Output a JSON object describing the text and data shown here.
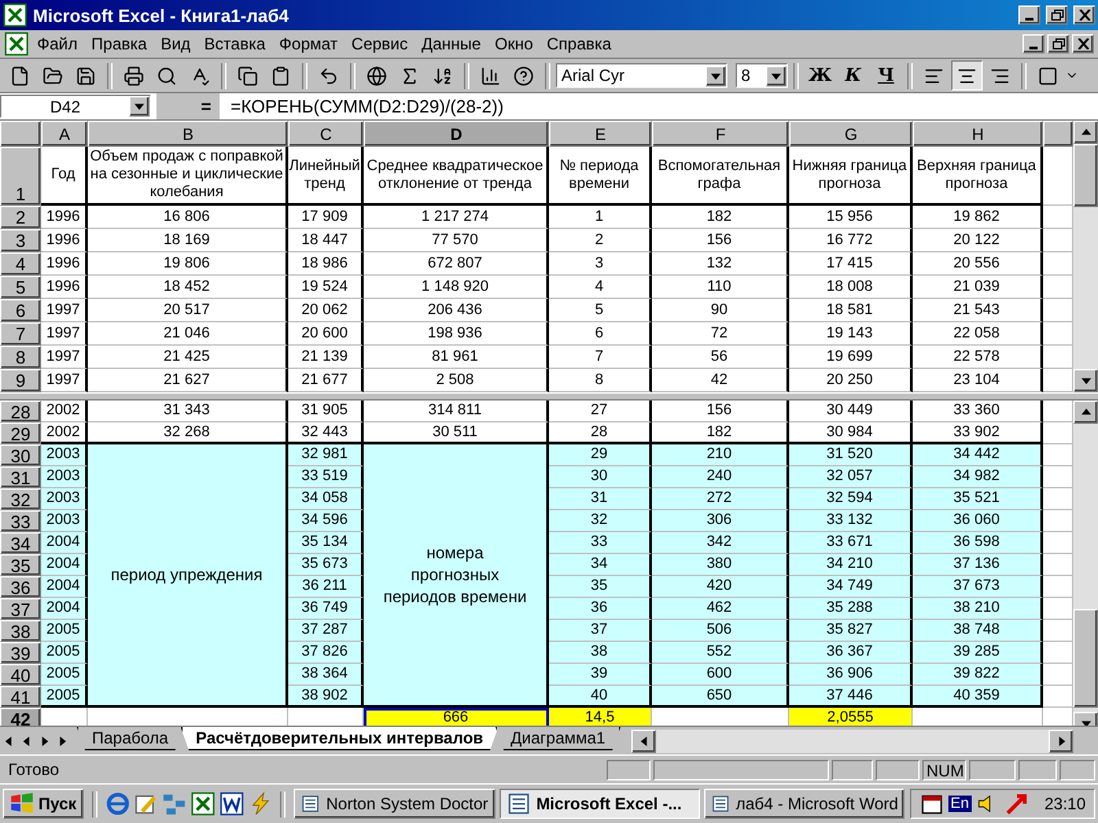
{
  "window": {
    "title": "Microsoft Excel - Книга1-лаб4"
  },
  "menu": [
    "Файл",
    "Правка",
    "Вид",
    "Вставка",
    "Формат",
    "Сервис",
    "Данные",
    "Окно",
    "Справка"
  ],
  "toolbar": {
    "font": "Arial Cyr",
    "size": "8",
    "format_buttons": [
      {
        "kind": "bold",
        "label": "Ж"
      },
      {
        "kind": "italic",
        "label": "К"
      },
      {
        "kind": "underline",
        "label": "Ч"
      }
    ],
    "align_buttons": [
      {
        "kind": "left",
        "selected": false
      },
      {
        "kind": "center",
        "selected": true
      },
      {
        "kind": "right",
        "selected": false
      }
    ]
  },
  "formula_bar": {
    "cell": "D42",
    "equals": "=",
    "formula": "=КОРЕНЬ(СУММ(D2:D29)/(28-2))"
  },
  "columns": [
    {
      "label": "A",
      "selected": false
    },
    {
      "label": "B",
      "selected": false
    },
    {
      "label": "C",
      "selected": false
    },
    {
      "label": "D",
      "selected": true
    },
    {
      "label": "E",
      "selected": false
    },
    {
      "label": "F",
      "selected": false
    },
    {
      "label": "G",
      "selected": false
    },
    {
      "label": "H",
      "selected": false
    }
  ],
  "header_row": {
    "row": "1",
    "cells": [
      "Год",
      "Объем продаж с поправкой на сезонные и циклические колебания",
      "Линейный тренд",
      "Среднее квадратическое отклонение от тренда",
      "№ периода времени",
      "Вспомогательная графа",
      "Нижняя граница прогноза",
      "Верхняя граница прогноза"
    ]
  },
  "top_rows": [
    {
      "row": "2",
      "cells": [
        "1996",
        "16 806",
        "17 909",
        "1 217 274",
        "1",
        "182",
        "15 956",
        "19 862"
      ]
    },
    {
      "row": "3",
      "cells": [
        "1996",
        "18 169",
        "18 447",
        "77 570",
        "2",
        "156",
        "16 772",
        "20 122"
      ]
    },
    {
      "row": "4",
      "cells": [
        "1996",
        "19 806",
        "18 986",
        "672 807",
        "3",
        "132",
        "17 415",
        "20 556"
      ]
    },
    {
      "row": "5",
      "cells": [
        "1996",
        "18 452",
        "19 524",
        "1 148 920",
        "4",
        "110",
        "18 008",
        "21 039"
      ]
    },
    {
      "row": "6",
      "cells": [
        "1997",
        "20 517",
        "20 062",
        "206 436",
        "5",
        "90",
        "18 581",
        "21 543"
      ]
    },
    {
      "row": "7",
      "cells": [
        "1997",
        "21 046",
        "20 600",
        "198 936",
        "6",
        "72",
        "19 143",
        "22 058"
      ]
    },
    {
      "row": "8",
      "cells": [
        "1997",
        "21 425",
        "21 139",
        "81 961",
        "7",
        "56",
        "19 699",
        "22 578"
      ]
    },
    {
      "row": "9",
      "cells": [
        "1997",
        "21 627",
        "21 677",
        "2 508",
        "8",
        "42",
        "20 250",
        "23 104"
      ]
    }
  ],
  "bottom_rows": [
    {
      "row": "28",
      "cells": [
        "2002",
        "31 343",
        "31 905",
        "314 811",
        "27",
        "156",
        "30 449",
        "33 360"
      ]
    },
    {
      "row": "29",
      "cells": [
        "2002",
        "32 268",
        "32 443",
        "30 511",
        "28",
        "182",
        "30 984",
        "33 902"
      ]
    }
  ],
  "forecast": {
    "label_b": "период упреждения",
    "label_d": "номера прогнозных периодов  времени",
    "rows": [
      {
        "row": "30",
        "cells": [
          "2003",
          "32 981",
          "29",
          "210",
          "31 520",
          "34 442"
        ]
      },
      {
        "row": "31",
        "cells": [
          "2003",
          "33 519",
          "30",
          "240",
          "32 057",
          "34 982"
        ]
      },
      {
        "row": "32",
        "cells": [
          "2003",
          "34 058",
          "31",
          "272",
          "32 594",
          "35 521"
        ]
      },
      {
        "row": "33",
        "cells": [
          "2003",
          "34 596",
          "32",
          "306",
          "33 132",
          "36 060"
        ]
      },
      {
        "row": "34",
        "cells": [
          "2004",
          "35 134",
          "33",
          "342",
          "33 671",
          "36 598"
        ]
      },
      {
        "row": "35",
        "cells": [
          "2004",
          "35 673",
          "34",
          "380",
          "34 210",
          "37 136"
        ]
      },
      {
        "row": "36",
        "cells": [
          "2004",
          "36 211",
          "35",
          "420",
          "34 749",
          "37 673"
        ]
      },
      {
        "row": "37",
        "cells": [
          "2004",
          "36 749",
          "36",
          "462",
          "35 288",
          "38 210"
        ]
      },
      {
        "row": "38",
        "cells": [
          "2005",
          "37 287",
          "37",
          "506",
          "35 827",
          "38 748"
        ]
      },
      {
        "row": "39",
        "cells": [
          "2005",
          "37 826",
          "38",
          "552",
          "36 367",
          "39 285"
        ]
      },
      {
        "row": "40",
        "cells": [
          "2005",
          "38 364",
          "39",
          "600",
          "36 906",
          "39 822"
        ]
      },
      {
        "row": "41",
        "cells": [
          "2005",
          "38 902",
          "40",
          "650",
          "37 446",
          "40 359"
        ]
      }
    ]
  },
  "total_row": {
    "row": "42",
    "selected": true,
    "cells": [
      {
        "highlighted": false,
        "selected": false
      },
      {
        "highlighted": false,
        "selected": false
      },
      {
        "highlighted": false,
        "selected": false
      },
      {
        "text": "666",
        "highlighted": true,
        "selected": true
      },
      {
        "text": "14,5",
        "highlighted": true,
        "selected": false
      },
      {
        "highlighted": false,
        "selected": false
      },
      {
        "text": "2,0555",
        "highlighted": true,
        "selected": false
      },
      {
        "highlighted": false,
        "selected": false
      }
    ]
  },
  "sheet_tabs": [
    {
      "label": "Парабола",
      "selected": false
    },
    {
      "label": "Расчётдоверительных интервалов",
      "selected": true
    },
    {
      "label": "Диаграмма1",
      "selected": false
    }
  ],
  "status_bar": {
    "text": "Готово",
    "indicator": "NUM"
  },
  "taskbar": {
    "start": "Пуск",
    "tasks": [
      {
        "label": "Norton System Doctor",
        "selected": false
      },
      {
        "label": "Microsoft Excel -...",
        "selected": true
      },
      {
        "label": "лаб4 - Microsoft Word",
        "selected": false
      }
    ],
    "language": "En",
    "clock": "23:10"
  }
}
